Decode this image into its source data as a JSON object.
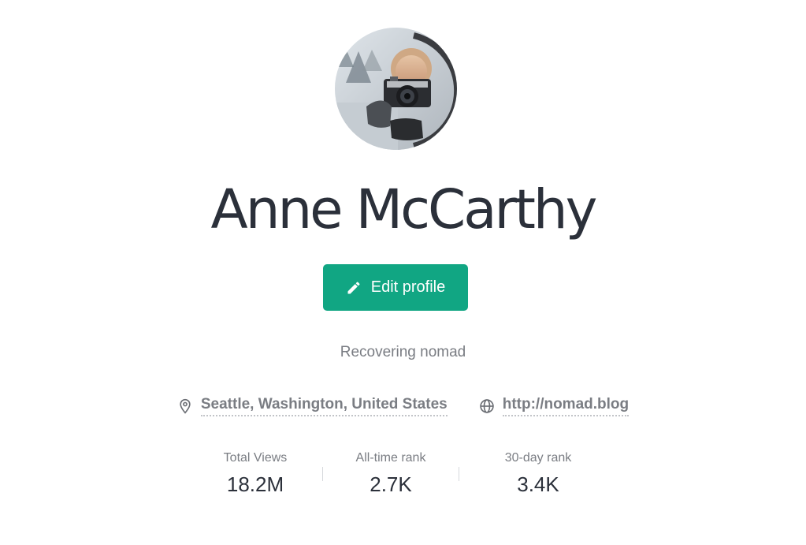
{
  "profile": {
    "name": "Anne McCarthy",
    "edit_label": "Edit profile",
    "bio": "Recovering nomad",
    "location": "Seattle, Washington, United States",
    "website": "http://nomad.blog",
    "location_icon": "map-pin-icon",
    "website_icon": "globe-icon",
    "edit_icon": "pencil-icon"
  },
  "stats": [
    {
      "label": "Total Views",
      "value": "18.2M"
    },
    {
      "label": "All-time rank",
      "value": "2.7K"
    },
    {
      "label": "30-day rank",
      "value": "3.4K"
    }
  ],
  "colors": {
    "accent": "#11a683",
    "text_primary": "#2b303a",
    "text_muted": "#7a7d83"
  }
}
